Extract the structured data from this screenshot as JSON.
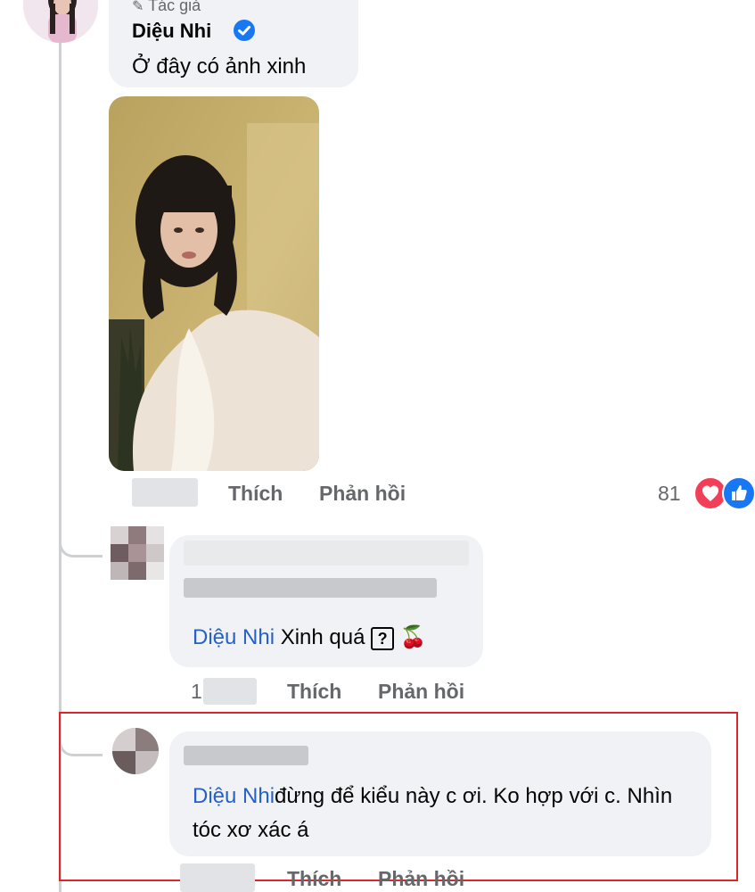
{
  "comment1": {
    "author_tag": "Tác giả",
    "author": "Diệu Nhi",
    "text": "Ở đây có ảnh xinh",
    "like_label": "Thích",
    "reply_label": "Phản hồi",
    "reaction_count": "81",
    "reaction_icons": [
      "heart-icon",
      "like-icon"
    ]
  },
  "reply1": {
    "mention": "Diệu Nhi",
    "text": "Xinh quá",
    "emoji_unknown": "?",
    "emoji": "🍒",
    "time_partial": "1",
    "like_label": "Thích",
    "reply_label": "Phản hồi"
  },
  "reply2": {
    "mention": "Diệu Nhi",
    "text": "đừng để kiểu này c ơi. Ko hợp với c. Nhìn tóc xơ xác á",
    "like_label": "Thích",
    "reply_label": "Phản hồi"
  },
  "colors": {
    "mention": "#2462c9",
    "verified": "#1877f2",
    "highlight_border": "#d9272e",
    "bubble": "#f0f2f5"
  }
}
